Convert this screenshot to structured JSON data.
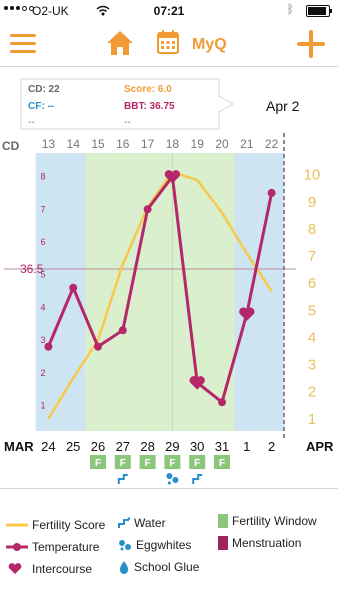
{
  "status_bar": {
    "carrier": "O2-UK",
    "time": "07:21"
  },
  "toolbar": {
    "myq_label": "MyQ"
  },
  "info": {
    "cd": "CD: 22",
    "cf": "CF: --",
    "score": "Score: 6.0",
    "bbt": "BBT: 36.75",
    "left_extra": "--",
    "right_extra": "--"
  },
  "selected_date": "Apr 2",
  "colors": {
    "accent": "#f29b36",
    "temperature": "#b52769",
    "fertility_score": "#f6c94a",
    "fertility_window": "#daf0cc",
    "menstruation_band": "#cde4f2",
    "cervical_fluid": "#2a8fc7",
    "fertile_marker": "#8bc67b",
    "menstruation_legend": "#a0255f"
  },
  "chart_data": {
    "type": "line",
    "cd_label": "CD",
    "cycle_days": [
      "13",
      "14",
      "15",
      "16",
      "17",
      "18",
      "19",
      "20",
      "21",
      "22"
    ],
    "left_axis_ticks": [
      "1",
      "2",
      "3",
      "4",
      "5",
      "6",
      "7",
      "8"
    ],
    "right_axis_ticks": [
      "1",
      "2",
      "3",
      "4",
      "5",
      "6",
      "7",
      "8",
      "9",
      "10"
    ],
    "reference_line_label": "36.5",
    "month_start": "MAR",
    "month_end": "APR",
    "dates": [
      "24",
      "25",
      "26",
      "27",
      "28",
      "29",
      "30",
      "31",
      "1",
      "2"
    ],
    "temperature": {
      "name": "Temperature",
      "values": [
        2.8,
        4.6,
        2.8,
        3.3,
        7.0,
        8.0,
        1.7,
        1.1,
        3.8,
        7.5
      ]
    },
    "fertility_score": {
      "name": "Fertility Score",
      "values": [
        1.0,
        2.5,
        3.9,
        6.7,
        8.8,
        10.1,
        9.8,
        8.6,
        7.1,
        5.7
      ]
    },
    "intercourse_days": [
      5,
      6,
      8
    ],
    "fertile_days": [
      2,
      3,
      4,
      5,
      6,
      7
    ],
    "fertile_marker_label": "F",
    "water_days": [
      3,
      6
    ],
    "eggwhite_days": [
      5
    ],
    "menstruation_bands": [
      [
        0,
        1
      ],
      [
        8,
        9
      ]
    ],
    "fertility_window": [
      2,
      7
    ]
  },
  "legend": {
    "fertility_score": "Fertility Score",
    "water": "Water",
    "fertility_window": "Fertility Window",
    "temperature": "Temperature",
    "eggwhites": "Eggwhites",
    "menstruation": "Menstruation",
    "intercourse": "Intercourse",
    "school_glue": "School Glue"
  }
}
